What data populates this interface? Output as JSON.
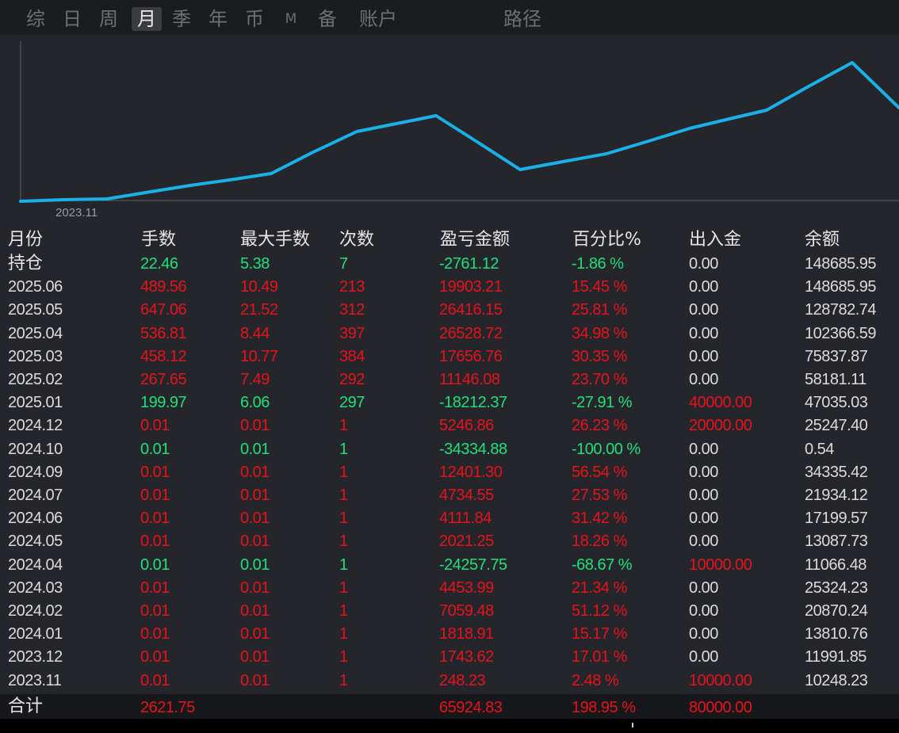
{
  "tabs": [
    {
      "label": "综",
      "active": false
    },
    {
      "label": "日",
      "active": false
    },
    {
      "label": "周",
      "active": false
    },
    {
      "label": "月",
      "active": true
    },
    {
      "label": "季",
      "active": false
    },
    {
      "label": "年",
      "active": false
    },
    {
      "label": "币",
      "active": false
    },
    {
      "label": "M",
      "active": false
    },
    {
      "label": "备",
      "active": false
    },
    {
      "label": "账户",
      "active": false
    },
    {
      "label": "路径",
      "active": false
    }
  ],
  "chart": {
    "x_tick_label": "2023.11",
    "line_color": "#1ab0e8"
  },
  "table": {
    "headers": [
      "月份",
      "手数",
      "最大手数",
      "次数",
      "盈亏金额",
      "百分比%",
      "出入金",
      "余额"
    ],
    "rows": [
      {
        "month": "持仓",
        "lots": "22.46",
        "max_lots": "5.38",
        "count": "7",
        "pnl": "-2761.12",
        "pct": "-1.86 %",
        "cash": "0.00",
        "balance": "148685.95",
        "tone": "green",
        "cash_tone": "white"
      },
      {
        "month": "2025.06",
        "lots": "489.56",
        "max_lots": "10.49",
        "count": "213",
        "pnl": "19903.21",
        "pct": "15.45 %",
        "cash": "0.00",
        "balance": "148685.95",
        "tone": "red",
        "cash_tone": "white"
      },
      {
        "month": "2025.05",
        "lots": "647.06",
        "max_lots": "21.52",
        "count": "312",
        "pnl": "26416.15",
        "pct": "25.81 %",
        "cash": "0.00",
        "balance": "128782.74",
        "tone": "red",
        "cash_tone": "white"
      },
      {
        "month": "2025.04",
        "lots": "536.81",
        "max_lots": "8.44",
        "count": "397",
        "pnl": "26528.72",
        "pct": "34.98 %",
        "cash": "0.00",
        "balance": "102366.59",
        "tone": "red",
        "cash_tone": "white"
      },
      {
        "month": "2025.03",
        "lots": "458.12",
        "max_lots": "10.77",
        "count": "384",
        "pnl": "17656.76",
        "pct": "30.35 %",
        "cash": "0.00",
        "balance": "75837.87",
        "tone": "red",
        "cash_tone": "white"
      },
      {
        "month": "2025.02",
        "lots": "267.65",
        "max_lots": "7.49",
        "count": "292",
        "pnl": "11146.08",
        "pct": "23.70 %",
        "cash": "0.00",
        "balance": "58181.11",
        "tone": "red",
        "cash_tone": "white"
      },
      {
        "month": "2025.01",
        "lots": "199.97",
        "max_lots": "6.06",
        "count": "297",
        "pnl": "-18212.37",
        "pct": "-27.91 %",
        "cash": "40000.00",
        "balance": "47035.03",
        "tone": "green",
        "cash_tone": "red"
      },
      {
        "month": "2024.12",
        "lots": "0.01",
        "max_lots": "0.01",
        "count": "1",
        "pnl": "5246.86",
        "pct": "26.23 %",
        "cash": "20000.00",
        "balance": "25247.40",
        "tone": "red",
        "cash_tone": "red"
      },
      {
        "month": "2024.10",
        "lots": "0.01",
        "max_lots": "0.01",
        "count": "1",
        "pnl": "-34334.88",
        "pct": "-100.00 %",
        "cash": "0.00",
        "balance": "0.54",
        "tone": "green",
        "cash_tone": "white"
      },
      {
        "month": "2024.09",
        "lots": "0.01",
        "max_lots": "0.01",
        "count": "1",
        "pnl": "12401.30",
        "pct": "56.54 %",
        "cash": "0.00",
        "balance": "34335.42",
        "tone": "red",
        "cash_tone": "white"
      },
      {
        "month": "2024.07",
        "lots": "0.01",
        "max_lots": "0.01",
        "count": "1",
        "pnl": "4734.55",
        "pct": "27.53 %",
        "cash": "0.00",
        "balance": "21934.12",
        "tone": "red",
        "cash_tone": "white"
      },
      {
        "month": "2024.06",
        "lots": "0.01",
        "max_lots": "0.01",
        "count": "1",
        "pnl": "4111.84",
        "pct": "31.42 %",
        "cash": "0.00",
        "balance": "17199.57",
        "tone": "red",
        "cash_tone": "white"
      },
      {
        "month": "2024.05",
        "lots": "0.01",
        "max_lots": "0.01",
        "count": "1",
        "pnl": "2021.25",
        "pct": "18.26 %",
        "cash": "0.00",
        "balance": "13087.73",
        "tone": "red",
        "cash_tone": "white"
      },
      {
        "month": "2024.04",
        "lots": "0.01",
        "max_lots": "0.01",
        "count": "1",
        "pnl": "-24257.75",
        "pct": "-68.67 %",
        "cash": "10000.00",
        "balance": "11066.48",
        "tone": "green",
        "cash_tone": "red"
      },
      {
        "month": "2024.03",
        "lots": "0.01",
        "max_lots": "0.01",
        "count": "1",
        "pnl": "4453.99",
        "pct": "21.34 %",
        "cash": "0.00",
        "balance": "25324.23",
        "tone": "red",
        "cash_tone": "white"
      },
      {
        "month": "2024.02",
        "lots": "0.01",
        "max_lots": "0.01",
        "count": "1",
        "pnl": "7059.48",
        "pct": "51.12 %",
        "cash": "0.00",
        "balance": "20870.24",
        "tone": "red",
        "cash_tone": "white"
      },
      {
        "month": "2024.01",
        "lots": "0.01",
        "max_lots": "0.01",
        "count": "1",
        "pnl": "1818.91",
        "pct": "15.17 %",
        "cash": "0.00",
        "balance": "13810.76",
        "tone": "red",
        "cash_tone": "white"
      },
      {
        "month": "2023.12",
        "lots": "0.01",
        "max_lots": "0.01",
        "count": "1",
        "pnl": "1743.62",
        "pct": "17.01 %",
        "cash": "0.00",
        "balance": "11991.85",
        "tone": "red",
        "cash_tone": "white"
      },
      {
        "month": "2023.11",
        "lots": "0.01",
        "max_lots": "0.01",
        "count": "1",
        "pnl": "248.23",
        "pct": "2.48 %",
        "cash": "10000.00",
        "balance": "10248.23",
        "tone": "red",
        "cash_tone": "red"
      }
    ],
    "footer": {
      "label": "合计",
      "lots": "2621.75",
      "pnl": "65924.83",
      "pct": "198.95 %",
      "cash": "80000.00"
    }
  },
  "colors": {
    "profit": "#e8121b",
    "loss": "#1fe07a",
    "neutral": "#dcdcdc",
    "accent_line": "#1ab0e8"
  }
}
